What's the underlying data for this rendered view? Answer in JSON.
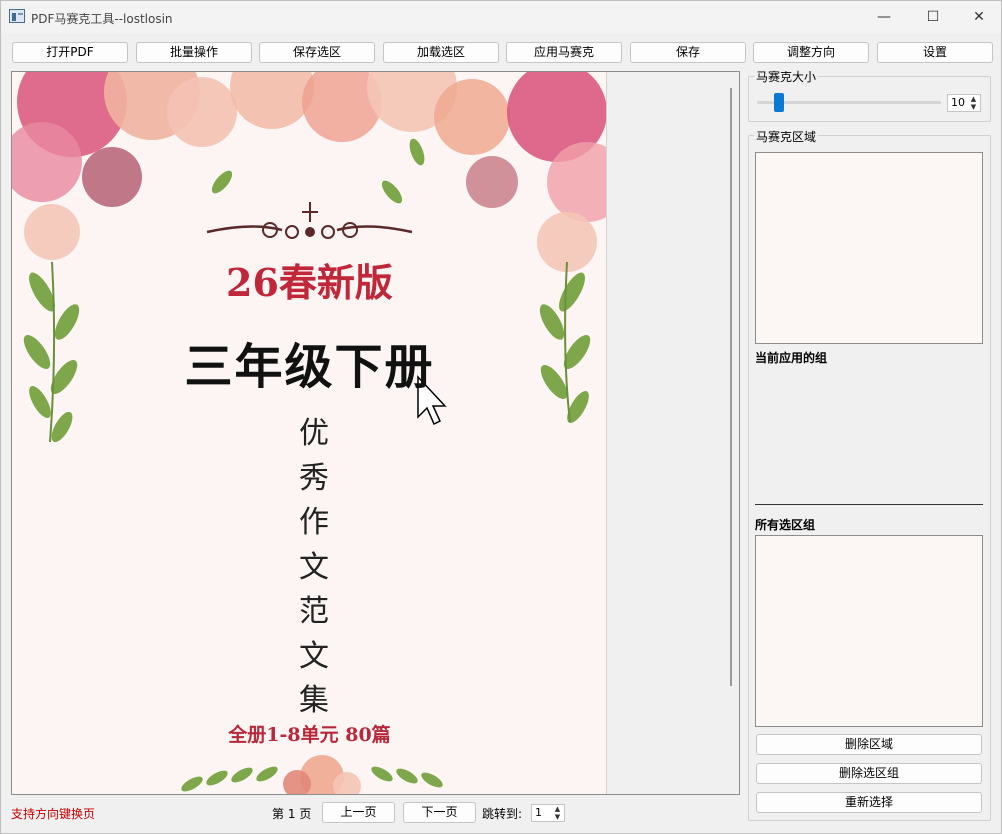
{
  "window": {
    "title": "PDF马赛克工具--lostlosin",
    "minimize": "—",
    "maximize": "☐",
    "close": "✕"
  },
  "toolbar": {
    "open_pdf": "打开PDF",
    "batch": "批量操作",
    "save_selection": "保存选区",
    "load_selection": "加载选区",
    "apply_mosaic": "应用马赛克",
    "save": "保存",
    "adjust_direction": "调整方向",
    "settings": "设置"
  },
  "page_content": {
    "edition": "26春新版",
    "grade": "三年级下册",
    "subtitle_chars": [
      "优",
      "秀",
      "作",
      "文",
      "范",
      "文",
      "集"
    ],
    "contents": "全册1-8单元 80篇"
  },
  "side": {
    "mosaic_size_title": "马赛克大小",
    "mosaic_size_value": "10",
    "mosaic_size_level": 0.12,
    "mosaic_area_title": "马赛克区域",
    "current_group_label": "当前应用的组",
    "all_groups_label": "所有选区组",
    "delete_area": "删除区域",
    "delete_group": "删除选区组",
    "reselect": "重新选择"
  },
  "bottom": {
    "hint": "支持方向键换页",
    "page_prefix": "第",
    "page_number": "1",
    "page_suffix": "页",
    "prev": "上一页",
    "next": "下一页",
    "jump_label": "跳转到:",
    "jump_value": "1"
  },
  "colors": {
    "accent": "#0b78d4",
    "hint": "#c00000",
    "edition_red": "#c0283a"
  }
}
